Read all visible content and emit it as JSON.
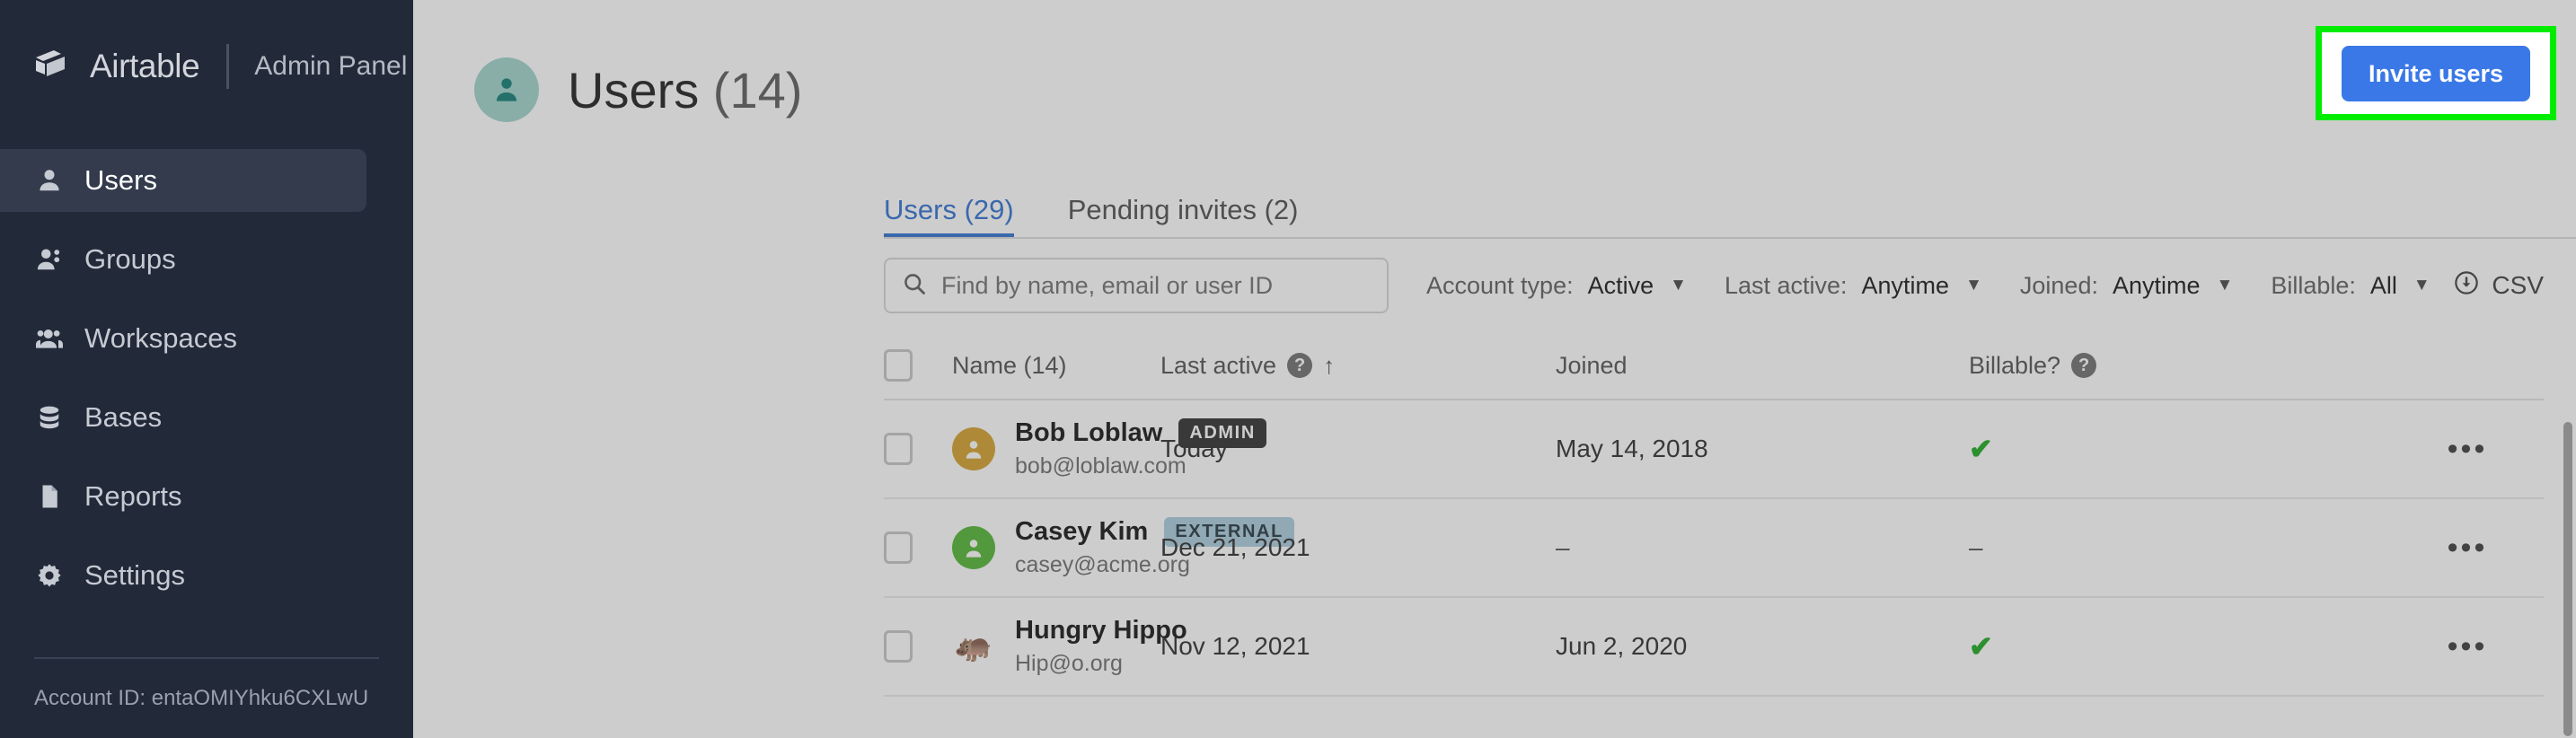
{
  "sidebar": {
    "brand": "Airtable",
    "subtitle": "Admin Panel",
    "items": [
      {
        "label": "Users",
        "icon": "user-icon",
        "active": true
      },
      {
        "label": "Groups",
        "icon": "users-icon",
        "active": false
      },
      {
        "label": "Workspaces",
        "icon": "user-group-icon",
        "active": false
      },
      {
        "label": "Bases",
        "icon": "database-icon",
        "active": false
      },
      {
        "label": "Reports",
        "icon": "document-icon",
        "active": false
      },
      {
        "label": "Settings",
        "icon": "gear-icon",
        "active": false
      }
    ],
    "account_id": "Account ID: entaOMIYhku6CXLwU"
  },
  "header": {
    "title": "Users",
    "count": "(14)",
    "avatar_icon": "person-icon",
    "avatar_bg": "#9ed3cb",
    "avatar_fg": "#0c7b72",
    "invite_button": "Invite users",
    "invite_button_color": "#3a78e7",
    "highlight_color": "#00ed00"
  },
  "tabs": [
    {
      "label": "Users (29)",
      "active": true
    },
    {
      "label": "Pending invites (2)",
      "active": false
    }
  ],
  "filters": {
    "search_placeholder": "Find by name, email or user ID",
    "search_value": "",
    "search_icon": "search-icon",
    "dropdowns": [
      {
        "label": "Account type:",
        "value": "Active"
      },
      {
        "label": "Last active:",
        "value": "Anytime"
      },
      {
        "label": "Joined:",
        "value": "Anytime"
      },
      {
        "label": "Billable:",
        "value": "All"
      }
    ],
    "export": {
      "label": "CSV",
      "icon": "download-icon"
    }
  },
  "table": {
    "columns": {
      "name": "Name (14)",
      "last_active": "Last active",
      "joined": "Joined",
      "billable": "Billable?",
      "sort_indicator": "↑",
      "help_icon": "?"
    },
    "rows": [
      {
        "name": "Bob Loblaw",
        "email": "bob@loblaw.com",
        "badge": "ADMIN",
        "badge_type": "admin",
        "avatar_type": "color",
        "avatar_color": "#d39f2a",
        "avatar_emoji": "",
        "last_active": "Today",
        "joined": "May 14, 2018",
        "billable": "check",
        "menu": "•••"
      },
      {
        "name": "Casey Kim",
        "email": "casey@acme.org",
        "badge": "EXTERNAL",
        "badge_type": "external",
        "avatar_type": "color",
        "avatar_color": "#4fb531",
        "avatar_emoji": "",
        "last_active": "Dec 21, 2021",
        "joined": "–",
        "billable": "dash",
        "menu": "•••"
      },
      {
        "name": "Hungry Hippo",
        "email": "Hip@o.org",
        "badge": "",
        "badge_type": "",
        "avatar_type": "emoji",
        "avatar_color": "transparent",
        "avatar_emoji": "🦛",
        "last_active": "Nov 12, 2021",
        "joined": "Jun 2, 2020",
        "billable": "check",
        "menu": "•••"
      }
    ]
  }
}
